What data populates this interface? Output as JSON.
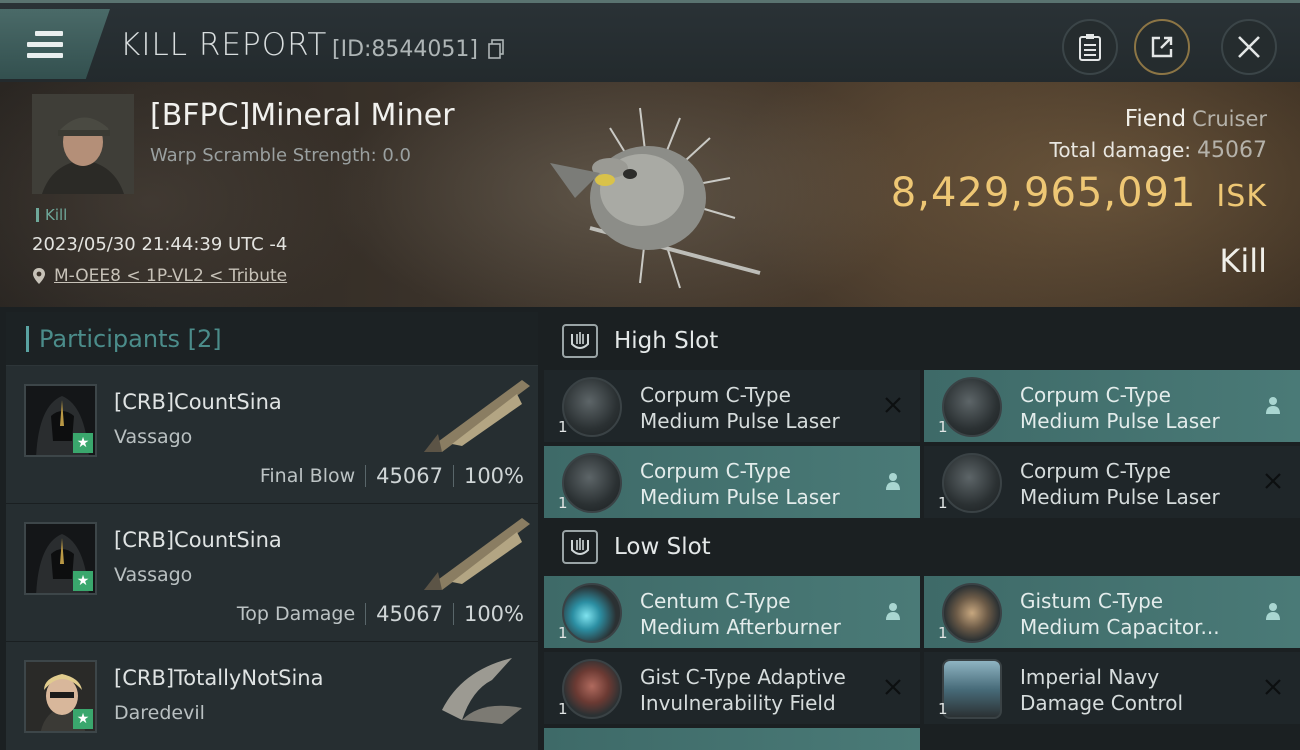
{
  "header": {
    "title": "KILL REPORT",
    "report_id": "[ID:8544051]"
  },
  "victim": {
    "name": "[BFPC]Mineral Miner",
    "warp_scramble": "Warp Scramble Strength: 0.0",
    "kill_tag": "Kill",
    "datetime": "2023/05/30 21:44:39 UTC -4",
    "location": "M-OEE8 < 1P-VL2 < Tribute",
    "ship_name": "Fiend",
    "ship_class": "Cruiser",
    "total_damage_label": "Total damage:",
    "total_damage_value": "45067",
    "isk_value": "8,429,965,091",
    "isk_unit": "ISK",
    "result": "Kill"
  },
  "participants": {
    "label": "Participants",
    "count": "[2]",
    "rows": [
      {
        "name": "[CRB]CountSina",
        "ship": "Vassago",
        "role": "Final Blow",
        "damage": "45067",
        "percent": "100%"
      },
      {
        "name": "[CRB]CountSina",
        "ship": "Vassago",
        "role": "Top Damage",
        "damage": "45067",
        "percent": "100%"
      },
      {
        "name": "[CRB]TotallyNotSina",
        "ship": "Daredevil",
        "role": "",
        "damage": "",
        "percent": ""
      }
    ]
  },
  "fitting": {
    "high_slot": {
      "label": "High Slot",
      "modules": [
        {
          "line1": "Corpum C-Type",
          "line2": "Medium Pulse Laser",
          "qty": "1",
          "status": "destroyed",
          "highlight": false
        },
        {
          "line1": "Corpum C-Type",
          "line2": "Medium Pulse Laser",
          "qty": "1",
          "status": "dropped",
          "highlight": true
        },
        {
          "line1": "Corpum C-Type",
          "line2": "Medium Pulse Laser",
          "qty": "1",
          "status": "dropped",
          "highlight": true
        },
        {
          "line1": "Corpum C-Type",
          "line2": "Medium Pulse Laser",
          "qty": "1",
          "status": "destroyed",
          "highlight": false
        }
      ]
    },
    "low_slot": {
      "label": "Low Slot",
      "modules": [
        {
          "line1": "Centum C-Type",
          "line2": "Medium Afterburner",
          "qty": "1",
          "status": "dropped",
          "highlight": true
        },
        {
          "line1": "Gistum C-Type",
          "line2": "Medium Capacitor...",
          "qty": "1",
          "status": "dropped",
          "highlight": true
        },
        {
          "line1": "Gist C-Type Adaptive",
          "line2": "Invulnerability Field",
          "qty": "1",
          "status": "destroyed",
          "highlight": false
        },
        {
          "line1": "Imperial Navy",
          "line2": "Damage Control",
          "qty": "1",
          "status": "destroyed",
          "highlight": false
        }
      ]
    }
  },
  "colors": {
    "accent_teal": "#5aa3a2",
    "isk_gold": "#eec774",
    "highlight_row": "#4a7a77",
    "star_green": "#3aa76d"
  }
}
